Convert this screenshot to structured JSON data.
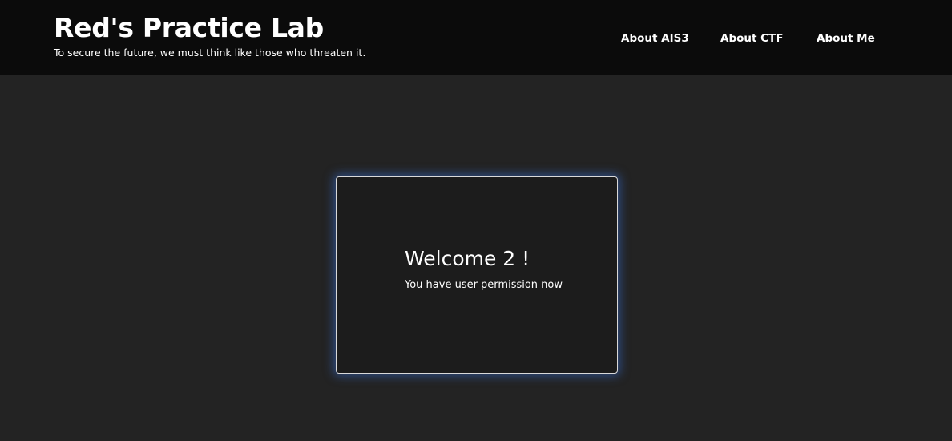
{
  "header": {
    "title": "Red's Practice Lab",
    "tagline": "To secure the future, we must think like those who threaten it."
  },
  "nav": {
    "items": [
      {
        "label": "About AIS3"
      },
      {
        "label": "About CTF"
      },
      {
        "label": "About Me"
      }
    ]
  },
  "card": {
    "title": "Welcome 2 !",
    "message": "You have user permission now"
  },
  "colors": {
    "page_background": "#232323",
    "header_background": "#0b0b0b",
    "card_background": "#1c1c1c",
    "card_border": "#d9d9d9",
    "card_glow": "#376ed2",
    "text": "#ffffff"
  }
}
